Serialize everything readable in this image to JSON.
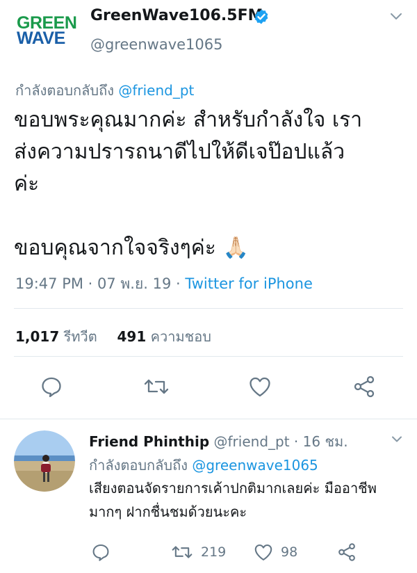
{
  "tweet": {
    "logo_line1": "GREEN",
    "logo_line2": "WAVE",
    "display_name": "GreenWave106.5FM",
    "handle": "@greenwave1065",
    "replying_to_label": "กำลังตอบกลับถึง",
    "replying_to_handle": "@friend_pt",
    "text_line1": "ขอบพระคุณมากค่ะ สำหรับกำลังใจ เรา",
    "text_line2": "ส่งความปรารถนาดีไปให้ดีเจป๊อปแล้ว",
    "text_line3": "ค่ะ",
    "text_line4": "ขอบคุณจากใจจริงๆค่ะ",
    "emoji": "🙏🏻",
    "time": "19:47 PM",
    "date": "07 พ.ย. 19",
    "source": "Twitter for iPhone",
    "retweet_count": "1,017",
    "retweet_label": "รีทวีต",
    "like_count": "491",
    "like_label": "ความชอบ"
  },
  "reply": {
    "name": "Friend Phinthip",
    "handle": "@friend_pt",
    "time": "16 ชม.",
    "replying_to_label": "กำลังตอบกลับถึง",
    "replying_to_handle": "@greenwave1065",
    "text": "เสียงตอนจัดรายการเค้าปกติมากเลยค่ะ มืออาชีพมากๆ ฝากชื่นชมด้วยนะคะ",
    "retweet_count": "219",
    "like_count": "98"
  },
  "icons": {
    "verified": "verified-badge-icon",
    "caret": "chevron-down-icon",
    "reply": "reply-icon",
    "retweet": "retweet-icon",
    "like": "heart-icon",
    "share": "share-icon"
  },
  "colors": {
    "link": "#1b95e0",
    "secondary_text": "#657786",
    "logo_green": "#1a9a4b",
    "logo_blue": "#1a5fa8"
  }
}
